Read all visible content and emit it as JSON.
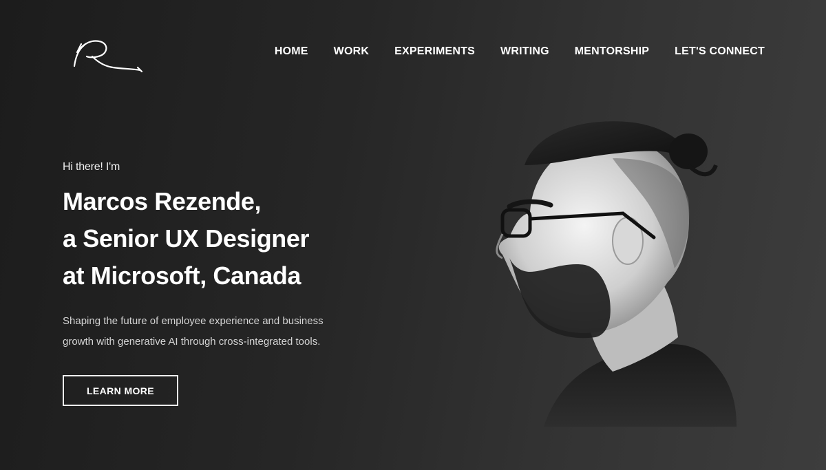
{
  "logo": {
    "icon": "signature-logo-icon"
  },
  "nav": {
    "items": [
      {
        "label": "HOME"
      },
      {
        "label": "WORK"
      },
      {
        "label": "EXPERIMENTS"
      },
      {
        "label": "WRITING"
      },
      {
        "label": "MENTORSHIP"
      },
      {
        "label": "LET'S CONNECT"
      }
    ]
  },
  "hero": {
    "greeting": "Hi there! I'm",
    "headline": [
      "Marcos Rezende,",
      "a Senior UX Designer",
      "at Microsoft, Canada"
    ],
    "subtitle": [
      "Shaping the future of employee experience and business",
      "growth with generative AI through cross-integrated tools."
    ],
    "cta_label": "LEARN MORE"
  },
  "portrait": {
    "description_icon": "profile-portrait-image"
  },
  "colors": {
    "background_dark": "#1c1c1c",
    "background_light": "#3d3d3d",
    "text": "#ffffff",
    "subtext": "#d4d4d4"
  }
}
